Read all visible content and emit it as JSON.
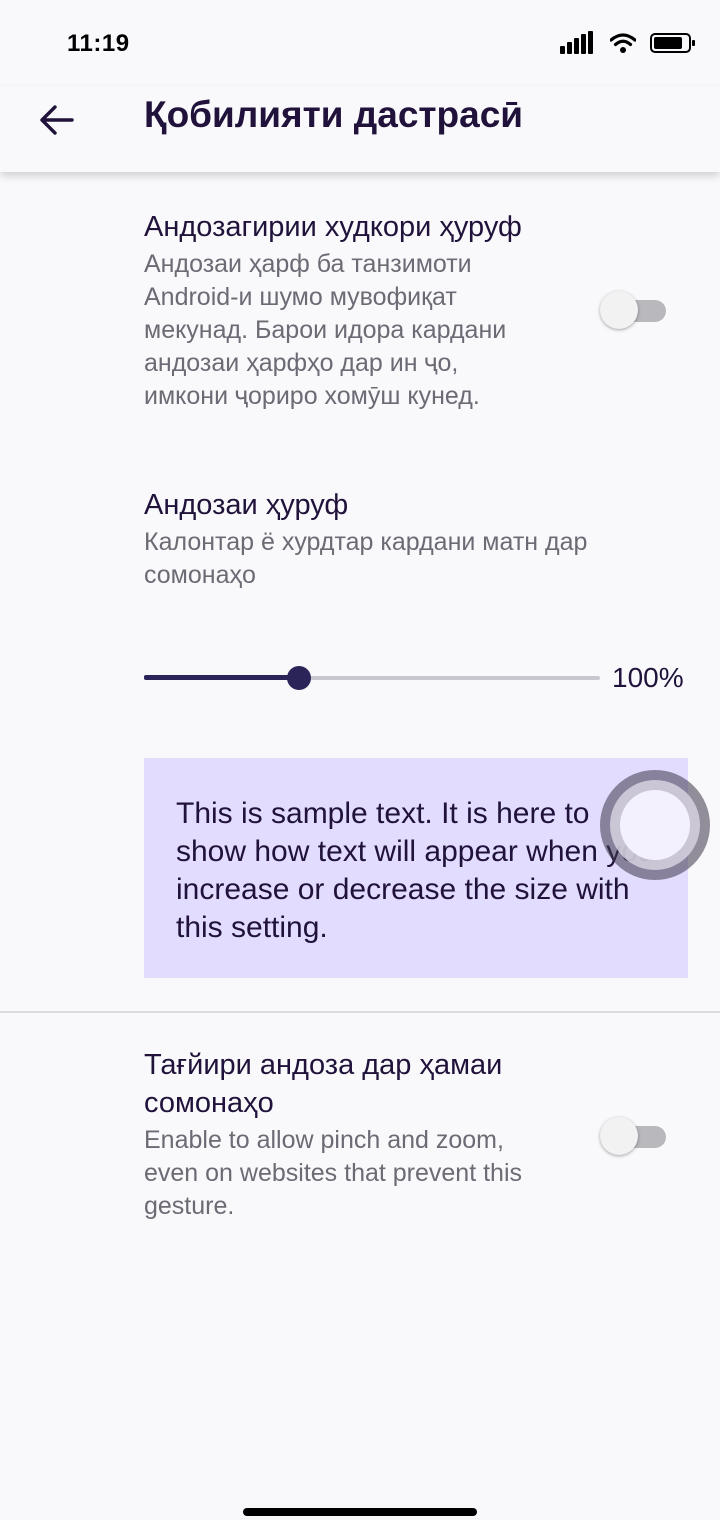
{
  "status_bar": {
    "time": "11:19",
    "icons": [
      "signal-icon",
      "wifi-icon",
      "battery-icon"
    ]
  },
  "app_bar": {
    "back_icon": "arrow-left-icon",
    "title": "Қобилияти дастрасӣ"
  },
  "settings": {
    "auto_font": {
      "title": "Андозагирии худкори ҳуруф",
      "summary": "Андозаи ҳарф ба танзимоти Android-и шумо мувофиқат мекунад. Барои идора кардани андозаи ҳарфҳо дар ин ҷо, имкони ҷориро хомӯш кунед.",
      "enabled": false
    },
    "font_size": {
      "title": "Андозаи ҳуруф",
      "summary": "Калонтар ё хурдтар кардани матн дар сомонаҳо",
      "value_label": "100%",
      "slider_fraction": 0.34
    },
    "sample_text": "This is sample text. It is here to show how text will appear when you increase or decrease the size with this setting.",
    "force_zoom": {
      "title": "Тағйири андоза дар ҳамаи сомонаҳо",
      "summary": "Enable to allow pinch and zoom, even on websites that prevent this gesture.",
      "enabled": false
    }
  },
  "colors": {
    "accent": "#2b2459",
    "sample_background": "#e2dcff",
    "background": "#f9f9fb",
    "summary_text": "#6c6a74"
  }
}
